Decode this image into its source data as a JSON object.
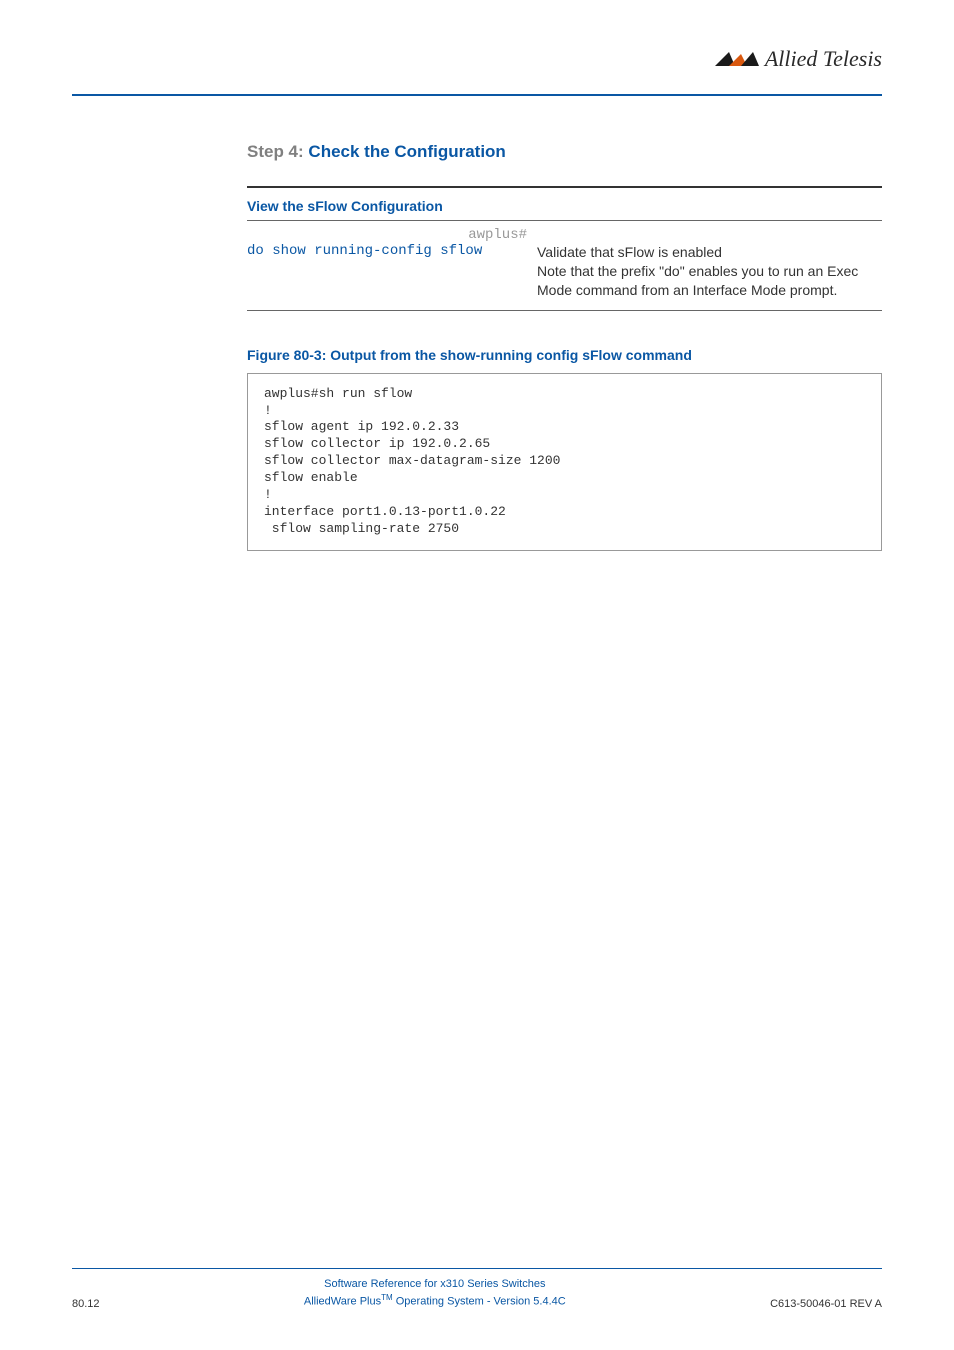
{
  "logo": {
    "text": "Allied Telesis"
  },
  "step": {
    "prefix": "Step 4:",
    "title": "Check the Configuration"
  },
  "section": {
    "heading": "View the sFlow Configuration",
    "prompt": "awplus#",
    "command": "do show running-config sflow",
    "description_line1": "Validate that sFlow is enabled",
    "description_rest": "Note that the prefix \"do\" enables you to run an Exec Mode command from an Interface Mode prompt."
  },
  "figure": {
    "caption": "Figure 80-3: Output from the show-running config sFlow command",
    "code": "awplus#sh run sflow\n!\nsflow agent ip 192.0.2.33\nsflow collector ip 192.0.2.65\nsflow collector max-datagram-size 1200\nsflow enable\n!\ninterface port1.0.13-port1.0.22\n sflow sampling-rate 2750"
  },
  "footer": {
    "page": "80.12",
    "line1": "Software Reference for x310 Series Switches",
    "line2_pre": "AlliedWare Plus",
    "line2_tm": "TM",
    "line2_post": " Operating System  - Version 5.4.4C",
    "rev": "C613-50046-01 REV A"
  }
}
